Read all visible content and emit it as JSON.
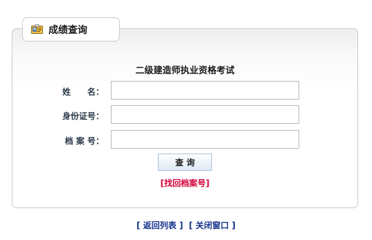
{
  "header": {
    "title": "成绩查询",
    "icon": "id-card-icon"
  },
  "form": {
    "title": "二级建造师执业资格考试",
    "fields": [
      {
        "label": "姓　　名：",
        "value": "",
        "placeholder": ""
      },
      {
        "label": "身份证号：",
        "value": "",
        "placeholder": ""
      },
      {
        "label": "档 案 号：",
        "value": "",
        "placeholder": ""
      }
    ],
    "query_label": "查 询",
    "recover_link": "[找回档案号]"
  },
  "footer": {
    "back_link": "[ 返回列表 ]",
    "close_link": "[ 关闭窗口 ]"
  },
  "colors": {
    "link_red": "#d4003a",
    "link_blue": "#14328c",
    "label": "#2b3a4a",
    "border": "#c9c9c9"
  }
}
